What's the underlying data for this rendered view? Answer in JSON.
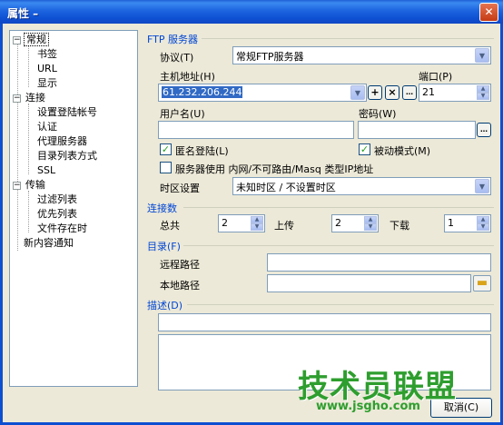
{
  "window": {
    "title": "属性 –",
    "close_glyph": "✕"
  },
  "tree": {
    "items": [
      {
        "label": "常规",
        "expander": "−"
      },
      {
        "label": "书签"
      },
      {
        "label": "URL"
      },
      {
        "label": "显示"
      },
      {
        "label": "连接",
        "expander": "−"
      },
      {
        "label": "设置登陆帐号"
      },
      {
        "label": "认证"
      },
      {
        "label": "代理服务器"
      },
      {
        "label": "目录列表方式"
      },
      {
        "label": "SSL"
      },
      {
        "label": "传输",
        "expander": "−"
      },
      {
        "label": "过滤列表"
      },
      {
        "label": "优先列表"
      },
      {
        "label": "文件存在时"
      },
      {
        "label": "新内容通知"
      }
    ]
  },
  "ftp": {
    "section_label": "FTP 服务器",
    "protocol_label": "协议(T)",
    "protocol_value": "常规FTP服务器",
    "host_label": "主机地址(H)",
    "host_value": "61.232.206.244",
    "port_label": "端口(P)",
    "port_value": "21",
    "user_label": "用户名(U)",
    "user_value": "",
    "password_label": "密码(W)",
    "password_value": "",
    "anonymous_label": "匿名登陆(L)",
    "anonymous_checked": "✓",
    "passive_label": "被动模式(M)",
    "passive_checked": "✓",
    "masq_label": "服务器使用 内网/不可路由/Masq 类型IP地址",
    "masq_checked": "",
    "timezone_label": "时区设置",
    "timezone_value": "未知时区 / 不设置时区"
  },
  "connections": {
    "section_label": "连接数",
    "total_label": "总共",
    "total_value": "2",
    "upload_label": "上传",
    "upload_value": "2",
    "download_label": "下载",
    "download_value": "1"
  },
  "directory": {
    "section_label": "目录(F)",
    "remote_label": "远程路径",
    "remote_value": "",
    "local_label": "本地路径",
    "local_value": ""
  },
  "description": {
    "section_label": "描述(D)",
    "value": ""
  },
  "buttons": {
    "cancel_label": "取消(C)"
  },
  "watermark": {
    "main": "技术员联盟",
    "sub": "www.jsgho.com"
  },
  "colors": {
    "accent": "#0046d5",
    "titlebar": "#0d4fd1",
    "selection": "#316ac5"
  }
}
